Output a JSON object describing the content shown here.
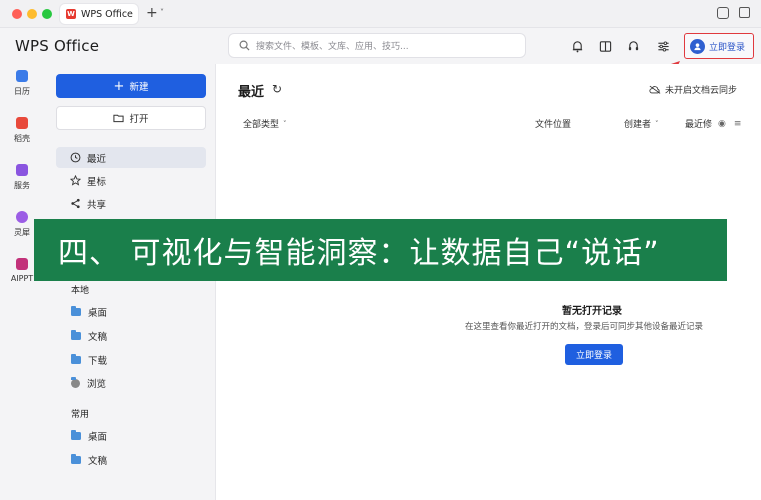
{
  "titlebar": {
    "tab_label": "WPS Office",
    "new_tab_symbol": "+",
    "tab_menu_symbol": "˅"
  },
  "header": {
    "brand": "WPS Office",
    "search_placeholder": "搜索文件、模板、文库、应用、技巧...",
    "login_label": "立即登录",
    "icons": [
      "bell-icon",
      "book-icon",
      "headset-icon",
      "settings-sliders-icon"
    ]
  },
  "rail": {
    "items": [
      {
        "label": "日历",
        "icon": "calendar-icon",
        "color": "#3b7be8"
      },
      {
        "label": "稻壳",
        "icon": "docer-icon",
        "color": "#e8493b"
      },
      {
        "label": "服务",
        "icon": "service-icon",
        "color": "#8a55e0"
      },
      {
        "label": "灵犀",
        "icon": "lingxi-icon",
        "color": "#9b5de5"
      },
      {
        "label": "AIPPT",
        "icon": "aippt-icon",
        "color": "#c2327a"
      }
    ]
  },
  "side": {
    "new_label": "新建",
    "open_label": "打开",
    "nav": [
      {
        "label": "最近",
        "icon": "clock-icon",
        "active": true
      },
      {
        "label": "星标",
        "icon": "star-icon",
        "active": false
      },
      {
        "label": "共享",
        "icon": "share-icon",
        "active": false
      }
    ],
    "local_heading": "本地",
    "local_items": [
      "桌面",
      "文稿",
      "下载",
      "浏览"
    ],
    "common_heading": "常用",
    "common_items": [
      "桌面",
      "文稿"
    ]
  },
  "main": {
    "title": "最近",
    "sync_label": "未开启文档云同步",
    "columns": {
      "type": "全部类型",
      "location": "文件位置",
      "creator": "创建者",
      "modified": "最近修"
    },
    "empty_title": "暂无打开记录",
    "empty_desc": "在这里查看你最近打开的文档，登录后可同步其他设备最近记录",
    "empty_login": "立即登录"
  },
  "banner": {
    "text": "四、 可视化与智能洞察：让数据自己“说话”",
    "color": "#1a7f4b"
  },
  "colors": {
    "accent_blue": "#1f5fe0",
    "highlight_red": "#e0393e"
  }
}
